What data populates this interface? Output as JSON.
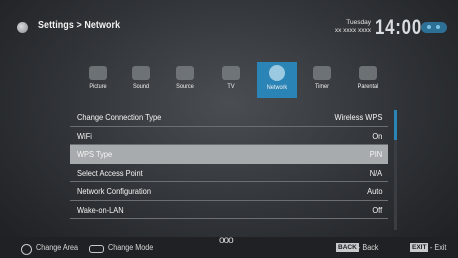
{
  "header": {
    "breadcrumb": "Settings > Network",
    "day": "Tuesday",
    "date": "xx xxxx xxxx",
    "time": "14:00"
  },
  "tabs": [
    {
      "label": "Picture",
      "icon": "picture-icon"
    },
    {
      "label": "Sound",
      "icon": "speaker-icon"
    },
    {
      "label": "Source",
      "icon": "antenna-icon"
    },
    {
      "label": "TV",
      "icon": "tv-icon"
    },
    {
      "label": "Network",
      "icon": "globe-icon",
      "active": true
    },
    {
      "label": "Timer",
      "icon": "timer-icon"
    },
    {
      "label": "Parental",
      "icon": "parental-icon"
    }
  ],
  "settings": [
    {
      "label": "Change Connection Type",
      "value": "Wireless WPS"
    },
    {
      "label": "WiFi",
      "value": "On"
    },
    {
      "label": "WPS Type",
      "value": "PIN",
      "selected": true
    },
    {
      "label": "Select Access Point",
      "value": "N/A"
    },
    {
      "label": "Network Configuration",
      "value": "Auto"
    },
    {
      "label": "Wake-on-LAN",
      "value": "Off"
    }
  ],
  "footer": {
    "change_area": "Change Area",
    "change_mode": "Change Mode",
    "more": "ooo",
    "back_key": "BACK",
    "back_label": "- Back",
    "exit_key": "EXIT",
    "exit_label": "- Exit"
  },
  "colors": {
    "accent": "#2a84b5",
    "selected_row": "#a8abae"
  }
}
